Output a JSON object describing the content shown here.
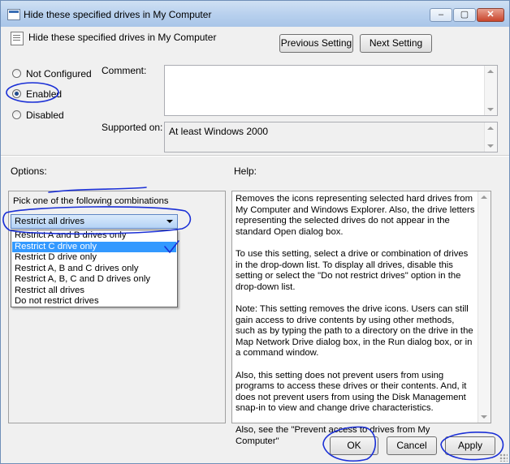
{
  "window": {
    "title": "Hide these specified drives in My Computer",
    "caption_buttons": {
      "minimize": "–",
      "maximize": "▢",
      "close": "✕"
    }
  },
  "header": {
    "policy_title": "Hide these specified drives in My Computer",
    "previous_label": "Previous Setting",
    "next_label": "Next Setting"
  },
  "state": {
    "options": [
      {
        "label": "Not Configured",
        "checked": false
      },
      {
        "label": "Enabled",
        "checked": true
      },
      {
        "label": "Disabled",
        "checked": false
      }
    ]
  },
  "comment_label": "Comment:",
  "comment_value": "",
  "supported_label": "Supported on:",
  "supported_value": "At least Windows 2000",
  "options_label": "Options:",
  "help_label": "Help:",
  "options_panel": {
    "prompt": "Pick one of the following combinations",
    "selected_value": "Restrict all drives",
    "dropdown_items": [
      "Restrict A and B drives only",
      "Restrict C drive only",
      "Restrict D drive only",
      "Restrict A, B and C drives only",
      "Restrict A, B, C and D drives only",
      "Restrict all drives",
      "Do not restrict drives"
    ],
    "highlighted_item": "Restrict C drive only"
  },
  "help_text": "Removes the icons representing selected hard drives from My Computer and Windows Explorer. Also, the drive letters representing the selected drives do not appear in the standard Open dialog box.\n\nTo use this setting, select a drive or combination of drives in the drop-down list. To display all drives, disable this setting or select the \"Do not restrict drives\" option in the drop-down list.\n\nNote: This setting removes the drive icons. Users can still gain access to drive contents by using other methods, such as by typing the path to a directory on the drive in the Map Network Drive dialog box, in the Run dialog box, or in a command window.\n\nAlso, this setting does not prevent users from using programs to access these drives or their contents. And, it does not prevent users from using the Disk Management snap-in to view and change drive characteristics.\n\nAlso, see the \"Prevent access to drives from My Computer\"",
  "footer": {
    "ok_label": "OK",
    "cancel_label": "Cancel",
    "apply_label": "Apply"
  },
  "annotation_color": "#1a2fd6"
}
